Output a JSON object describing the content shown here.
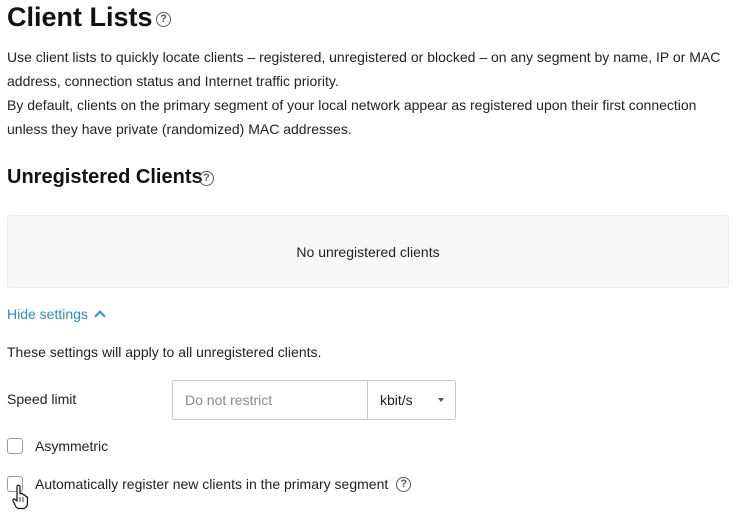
{
  "header": {
    "title": "Client Lists",
    "help_glyph": "?"
  },
  "intro": {
    "line1": "Use client lists to quickly locate clients – registered, unregistered or blocked – on any segment by name, IP or MAC address, connection status and Internet traffic priority.",
    "line2": "By default, clients on the primary segment of your local network appear as registered upon their first connection unless they have private (randomized) MAC addresses."
  },
  "unregistered": {
    "title": "Unregistered Clients",
    "help_glyph": "?",
    "empty_text": "No unregistered clients",
    "toggle_label": "Hide settings",
    "note": "These settings will apply to all unregistered clients.",
    "speed_limit": {
      "label": "Speed limit",
      "value": "",
      "placeholder": "Do not restrict",
      "unit": "kbit/s"
    },
    "asymmetric": {
      "label": "Asymmetric",
      "checked": false
    },
    "auto_register": {
      "label": "Automatically register new clients in the primary segment",
      "checked": false,
      "help_glyph": "?"
    }
  },
  "icons": {
    "help": "question-circle-icon",
    "toggle": "chevron-up-icon",
    "select": "caret-down-icon",
    "cursor": "hand-pointer-cursor"
  },
  "colors": {
    "link": "#2e8cc6",
    "empty_box_bg": "#f7f7f7",
    "text": "#222222"
  }
}
